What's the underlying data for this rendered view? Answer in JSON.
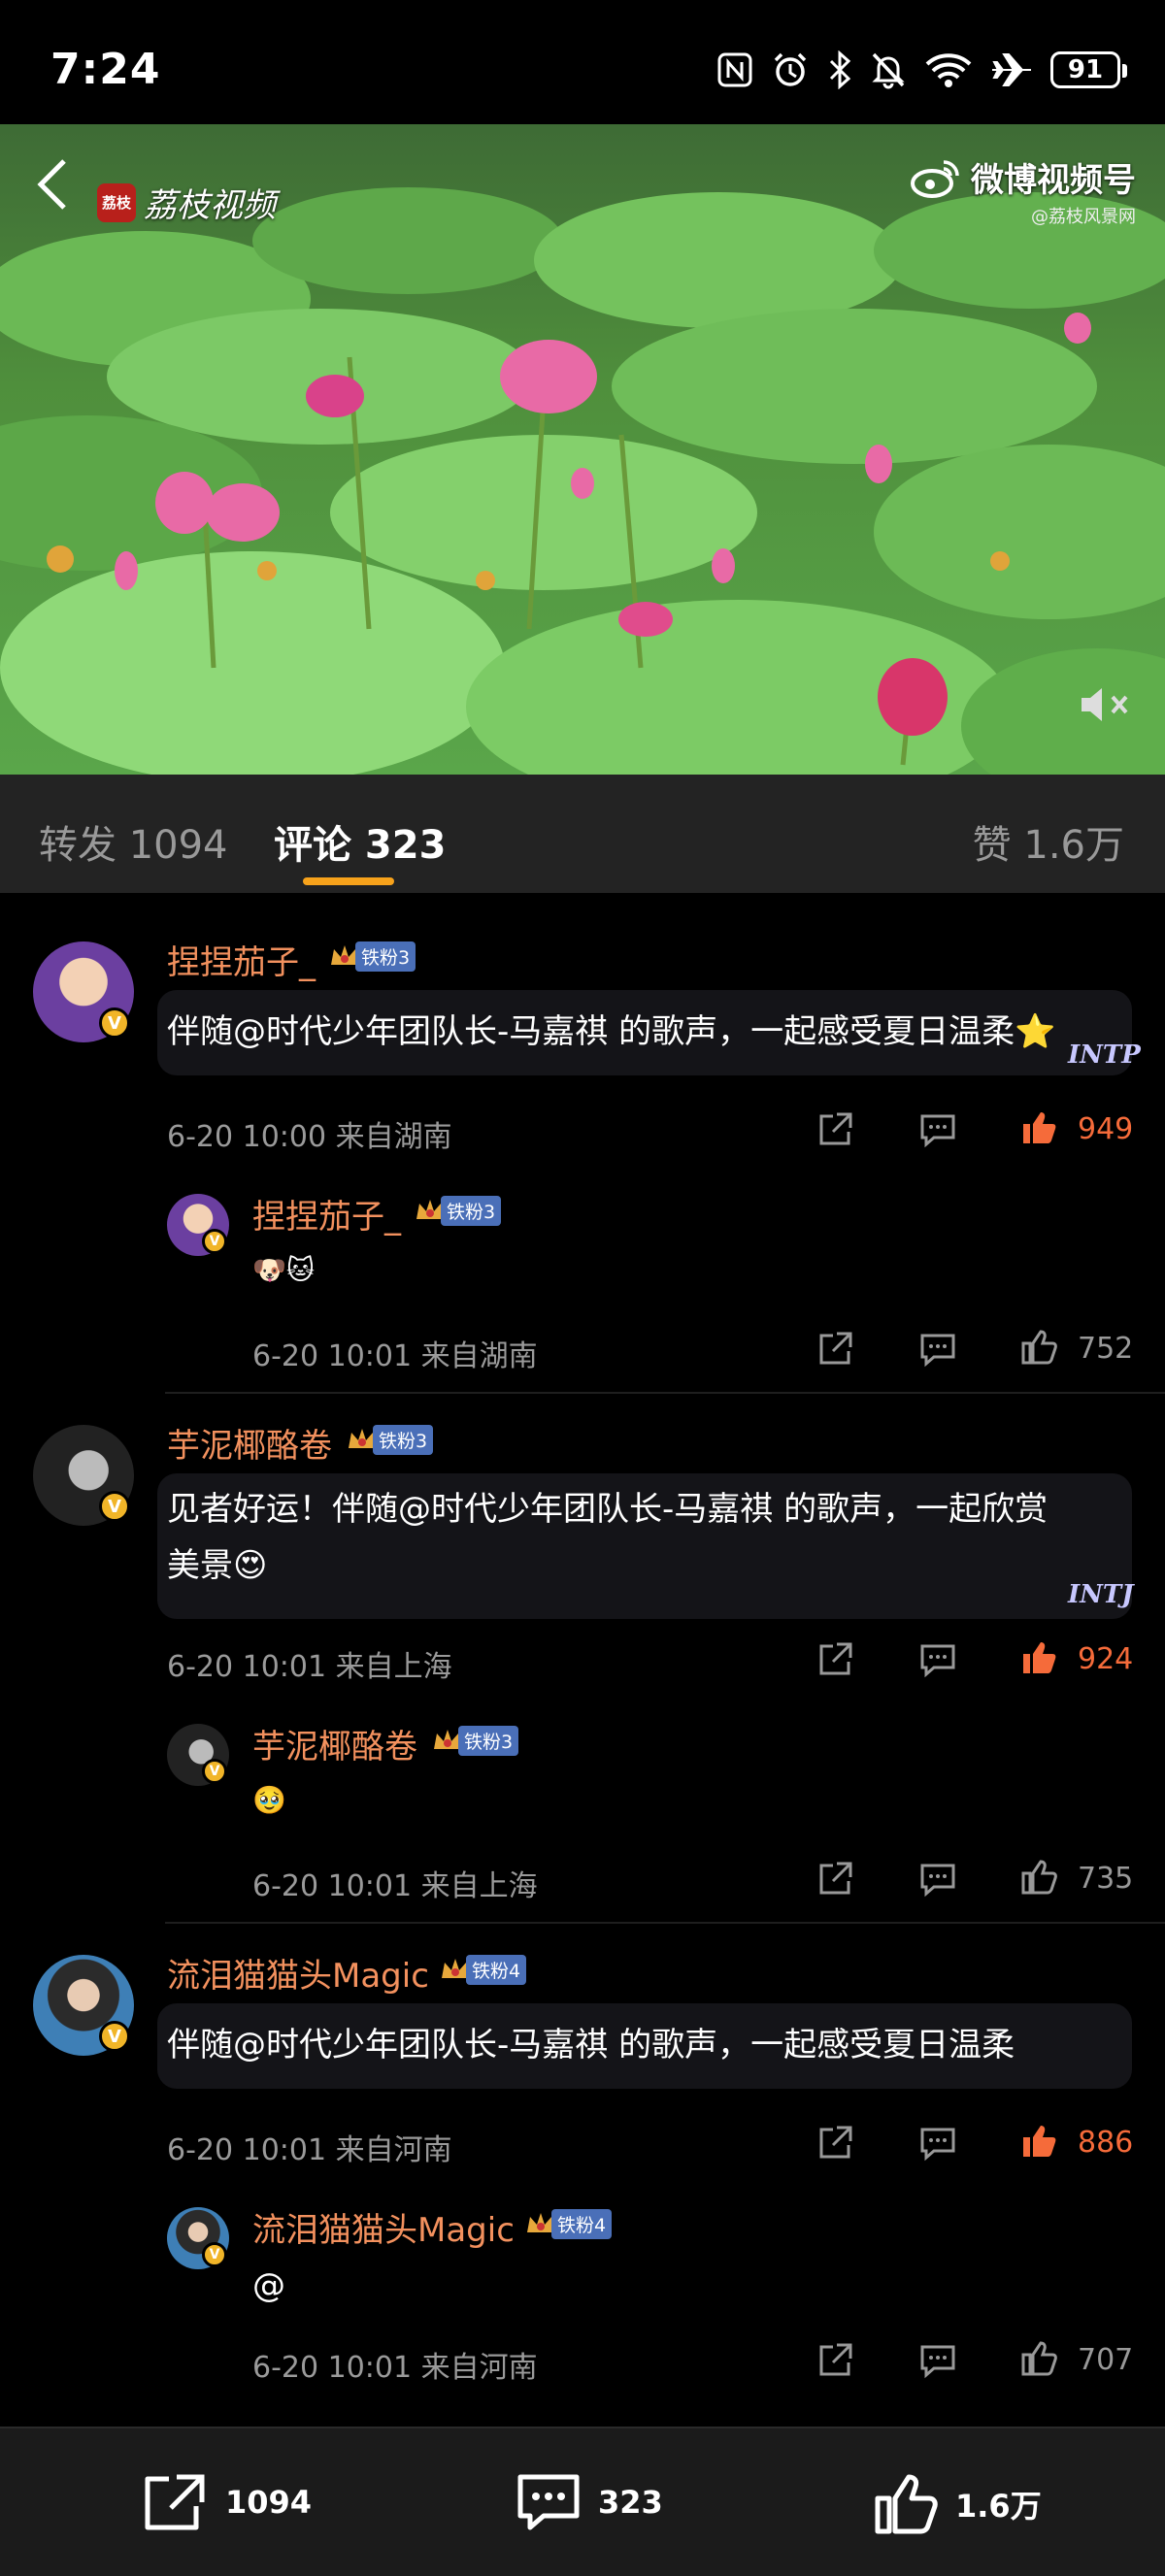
{
  "status_bar": {
    "time": "7:24",
    "battery": "91"
  },
  "video": {
    "brand_left": "荔枝视频",
    "brand_left_logo": "荔枝",
    "brand_right": "微博视频号",
    "watermark": "@荔枝风景网"
  },
  "tabs": [
    {
      "label": "转发 1094"
    },
    {
      "label": "评论 323"
    },
    {
      "label": "赞 1.6万"
    }
  ],
  "comments": [
    {
      "user": "捏捏茄子_",
      "fan_level": "铁粉3",
      "text": "伴随@时代少年团队长-马嘉祺 的歌声，一起感受夏日温柔⭐",
      "time": "6-20 10:00",
      "location": "来自湖南",
      "likes": "949",
      "mbti": "INTP",
      "reply": {
        "user": "捏捏茄子_",
        "fan_level": "铁粉3",
        "text": "🐶🐱",
        "time": "6-20 10:01",
        "location": "来自湖南",
        "likes": "752"
      }
    },
    {
      "user": "芋泥椰酪卷",
      "fan_level": "铁粉3",
      "text_line1": "见者好运！伴随@时代少年团队长-马嘉祺 的歌声，一起欣赏",
      "text_line2": "美景😍",
      "time": "6-20 10:01",
      "location": "来自上海",
      "likes": "924",
      "mbti": "INTJ",
      "reply": {
        "user": "芋泥椰酪卷",
        "fan_level": "铁粉3",
        "text": "🥹",
        "time": "6-20 10:01",
        "location": "来自上海",
        "likes": "735"
      }
    },
    {
      "user": "流泪猫猫头Magic",
      "fan_level": "铁粉4",
      "text": "伴随@时代少年团队长-马嘉祺 的歌声，一起感受夏日温柔",
      "time": "6-20 10:01",
      "location": "来自河南",
      "likes": "886",
      "reply": {
        "user": "流泪猫猫头Magic",
        "fan_level": "铁粉4",
        "text": "@",
        "time": "6-20 10:01",
        "location": "来自河南",
        "likes": "707"
      }
    }
  ],
  "bottom_bar": {
    "repost": "1094",
    "comment": "323",
    "like": "1.6万"
  },
  "colors": {
    "username": "#f3915e",
    "like_active": "#f56b3a",
    "tab_underline": "#f7a21b",
    "fan_badge": "#4a6fb8",
    "verified": "#f1b528"
  },
  "icons": [
    "nfc-icon",
    "alarm-icon",
    "bluetooth-icon",
    "mute-bell-icon",
    "wifi-icon",
    "airplane-icon",
    "battery-icon",
    "back-arrow-icon",
    "weibo-logo-icon",
    "speaker-mute-icon",
    "share-icon",
    "comment-icon",
    "like-icon",
    "crown-icon",
    "verified-icon"
  ]
}
